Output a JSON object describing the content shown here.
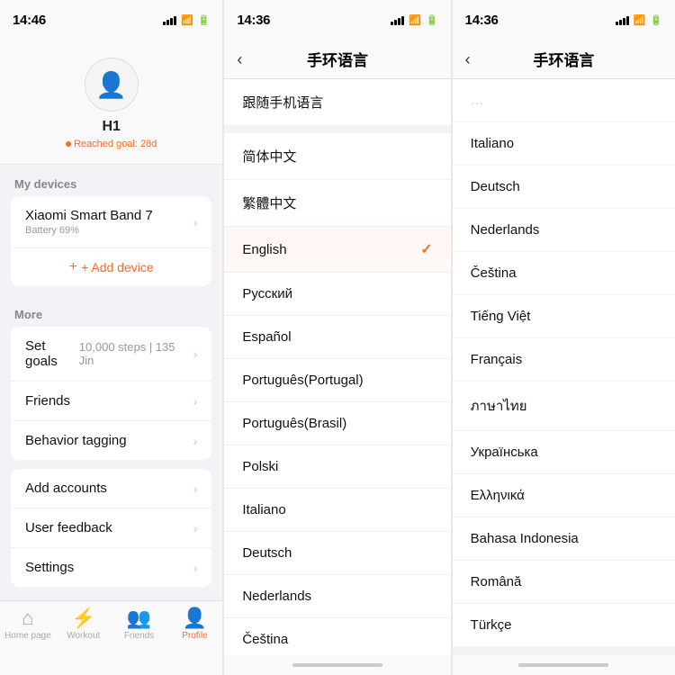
{
  "panel1": {
    "statusTime": "14:46",
    "statusArrow": "◀",
    "profile": {
      "avatarIcon": "👤",
      "name": "H1",
      "goalText": "Reached goal: 28d"
    },
    "devicesSection": {
      "header": "My devices",
      "device": {
        "name": "Xiaomi Smart Band 7",
        "battery": "Battery 69%"
      },
      "addDevice": "+ Add device"
    },
    "moreSection": {
      "header": "More",
      "items": [
        {
          "label": "Set goals",
          "value": "10,000 steps | 135 Jin",
          "hasChevron": true
        },
        {
          "label": "Friends",
          "value": "",
          "hasChevron": true
        },
        {
          "label": "Behavior tagging",
          "value": "",
          "hasChevron": true
        }
      ]
    },
    "accountSection": {
      "items": [
        {
          "label": "Add accounts",
          "value": "",
          "hasChevron": true
        },
        {
          "label": "User feedback",
          "value": "",
          "hasChevron": true
        },
        {
          "label": "Settings",
          "value": "",
          "hasChevron": true
        }
      ]
    },
    "tabBar": {
      "items": [
        {
          "icon": "🏠",
          "label": "Home page",
          "active": false
        },
        {
          "icon": "🏃",
          "label": "Workout",
          "active": false
        },
        {
          "icon": "👥",
          "label": "Friends",
          "active": false
        },
        {
          "icon": "👤",
          "label": "Profile",
          "active": true
        }
      ]
    }
  },
  "panel2": {
    "statusTime": "14:36",
    "navBack": "‹",
    "navTitle": "手环语言",
    "languages": [
      {
        "text": "跟随手机语言",
        "checked": false
      },
      {
        "text": "简体中文",
        "checked": false
      },
      {
        "text": "繁體中文",
        "checked": false
      },
      {
        "text": "English",
        "checked": true
      },
      {
        "text": "Русский",
        "checked": false
      },
      {
        "text": "Español",
        "checked": false
      },
      {
        "text": "Português(Portugal)",
        "checked": false
      },
      {
        "text": "Português(Brasil)",
        "checked": false
      },
      {
        "text": "Polski",
        "checked": false
      },
      {
        "text": "Italiano",
        "checked": false
      },
      {
        "text": "Deutsch",
        "checked": false
      },
      {
        "text": "Nederlands",
        "checked": false
      },
      {
        "text": "Čeština",
        "checked": false
      }
    ]
  },
  "panel3": {
    "statusTime": "14:36",
    "navBack": "‹",
    "navTitle": "手环语言",
    "languages": [
      {
        "text": "......",
        "checked": false
      },
      {
        "text": "Italiano",
        "checked": false
      },
      {
        "text": "Deutsch",
        "checked": false
      },
      {
        "text": "Nederlands",
        "checked": false
      },
      {
        "text": "Čeština",
        "checked": false
      },
      {
        "text": "Tiếng Việt",
        "checked": false
      },
      {
        "text": "Français",
        "checked": false
      },
      {
        "text": "ภาษาไทย",
        "checked": false
      },
      {
        "text": "Українська",
        "checked": false
      },
      {
        "text": "Ελληνικά",
        "checked": false
      },
      {
        "text": "Bahasa Indonesia",
        "checked": false
      },
      {
        "text": "Română",
        "checked": false
      },
      {
        "text": "Türkçe",
        "checked": false
      }
    ]
  }
}
